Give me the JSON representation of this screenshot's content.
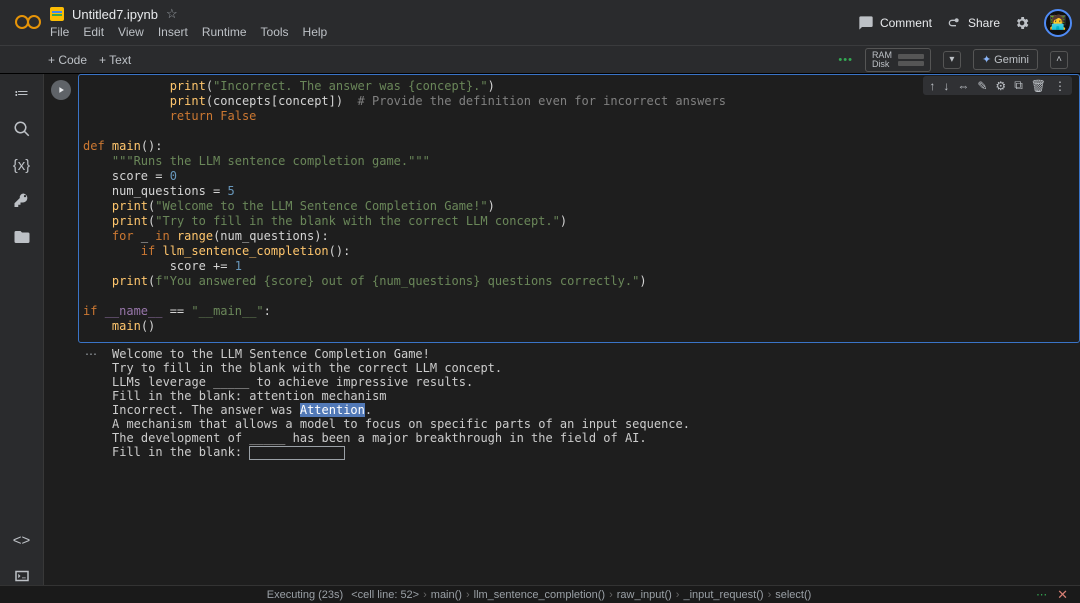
{
  "header": {
    "title": "Untitled7.ipynb",
    "menus": [
      "File",
      "Edit",
      "View",
      "Insert",
      "Runtime",
      "Tools",
      "Help"
    ],
    "comment": "Comment",
    "share": "Share"
  },
  "toolbar": {
    "code": "+ Code",
    "text": "+ Text",
    "ram_label": "RAM",
    "disk_label": "Disk",
    "gemini": "Gemini"
  },
  "code_lines": [
    {
      "indent": 3,
      "segs": [
        [
          "fn",
          "print"
        ],
        [
          "op",
          "("
        ],
        [
          "str",
          "\"Incorrect. The answer was {concept}.\""
        ],
        [
          "op",
          ")"
        ]
      ]
    },
    {
      "indent": 3,
      "segs": [
        [
          "fn",
          "print"
        ],
        [
          "op",
          "(concepts[concept])  "
        ],
        [
          "cm",
          "# Provide the definition even for incorrect answers"
        ]
      ]
    },
    {
      "indent": 3,
      "segs": [
        [
          "kw",
          "return "
        ],
        [
          "kw",
          "False"
        ]
      ]
    },
    {
      "indent": 0,
      "segs": [
        [
          "",
          ""
        ]
      ]
    },
    {
      "indent": 0,
      "segs": [
        [
          "kw",
          "def "
        ],
        [
          "fn",
          "main"
        ],
        [
          "op",
          "():"
        ]
      ]
    },
    {
      "indent": 1,
      "segs": [
        [
          "str",
          "\"\"\"Runs the LLM sentence completion game.\"\"\""
        ]
      ]
    },
    {
      "indent": 1,
      "segs": [
        [
          "op",
          "score = "
        ],
        [
          "num",
          "0"
        ]
      ]
    },
    {
      "indent": 1,
      "segs": [
        [
          "op",
          "num_questions = "
        ],
        [
          "num",
          "5"
        ]
      ]
    },
    {
      "indent": 1,
      "segs": [
        [
          "fn",
          "print"
        ],
        [
          "op",
          "("
        ],
        [
          "str",
          "\"Welcome to the LLM Sentence Completion Game!\""
        ],
        [
          "op",
          ")"
        ]
      ]
    },
    {
      "indent": 1,
      "segs": [
        [
          "fn",
          "print"
        ],
        [
          "op",
          "("
        ],
        [
          "str",
          "\"Try to fill in the blank with the correct LLM concept.\""
        ],
        [
          "op",
          ")"
        ]
      ]
    },
    {
      "indent": 1,
      "segs": [
        [
          "kw",
          "for "
        ],
        [
          "op",
          "_ "
        ],
        [
          "kw",
          "in "
        ],
        [
          "fn",
          "range"
        ],
        [
          "op",
          "(num_questions):"
        ]
      ]
    },
    {
      "indent": 2,
      "segs": [
        [
          "kw",
          "if "
        ],
        [
          "fn",
          "llm_sentence_completion"
        ],
        [
          "op",
          "():"
        ]
      ]
    },
    {
      "indent": 3,
      "segs": [
        [
          "op",
          "score += "
        ],
        [
          "num",
          "1"
        ]
      ]
    },
    {
      "indent": 1,
      "segs": [
        [
          "fn",
          "print"
        ],
        [
          "op",
          "("
        ],
        [
          "str",
          "f\"You answered {score} out of {num_questions} questions correctly.\""
        ],
        [
          "op",
          ")"
        ]
      ]
    },
    {
      "indent": 0,
      "segs": [
        [
          "",
          ""
        ]
      ]
    },
    {
      "indent": 0,
      "segs": [
        [
          "kw",
          "if "
        ],
        [
          "var",
          "__name__"
        ],
        [
          "op",
          " == "
        ],
        [
          "str",
          "\"__main__\""
        ],
        [
          "op",
          ":"
        ]
      ]
    },
    {
      "indent": 1,
      "segs": [
        [
          "fn",
          "main"
        ],
        [
          "op",
          "()"
        ]
      ]
    }
  ],
  "output_lines": [
    "Welcome to the LLM Sentence Completion Game!",
    "Try to fill in the blank with the correct LLM concept.",
    "LLMs leverage _____ to achieve impressive results.",
    "Fill in the blank: attention mechanism",
    "Incorrect. The answer was |HL|Attention|/HL|.",
    "A mechanism that allows a model to focus on specific parts of an input sequence.",
    "The development of _____ has been a major breakthrough in the field of AI.",
    "Fill in the blank: |INPUT|"
  ],
  "footer": {
    "exec": "Executing (23s)",
    "frames": [
      "<cell line: 52>",
      "main()",
      "llm_sentence_completion()",
      "raw_input()",
      "_input_request()",
      "select()"
    ]
  }
}
